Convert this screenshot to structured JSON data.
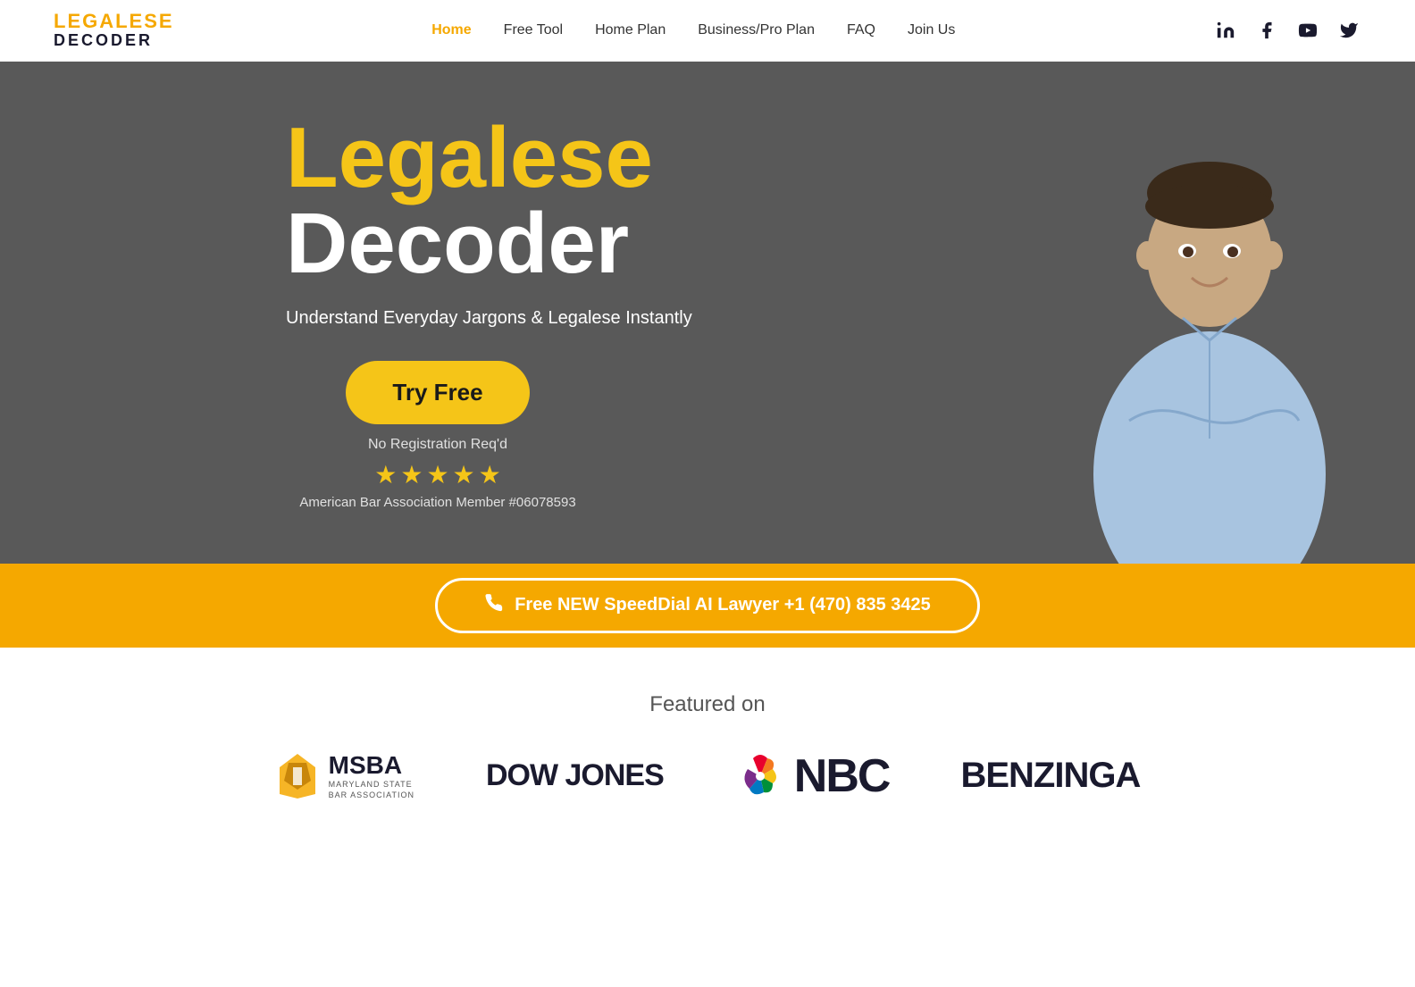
{
  "header": {
    "logo_top": "LEGALESE",
    "logo_bottom": "DECODER",
    "nav_items": [
      {
        "label": "Home",
        "active": true
      },
      {
        "label": "Free Tool",
        "active": false
      },
      {
        "label": "Home Plan",
        "active": false
      },
      {
        "label": "Business/Pro Plan",
        "active": false
      },
      {
        "label": "FAQ",
        "active": false
      },
      {
        "label": "Join Us",
        "active": false
      }
    ],
    "social": [
      "linkedin",
      "facebook",
      "youtube",
      "twitter"
    ]
  },
  "hero": {
    "title_yellow": "Legalese",
    "title_white": "Decoder",
    "subtitle": "Understand Everyday Jargons & Legalese Instantly",
    "cta_button": "Try Free",
    "no_registration": "No Registration Req'd",
    "aba_text": "American Bar Association Member #06078593",
    "stars_count": 4.5
  },
  "speed_dial": {
    "label": "Free NEW SpeedDial AI Lawyer +1 (470) 835 3425"
  },
  "featured": {
    "title": "Featured on",
    "logos": [
      "MSBA",
      "DOW JONES",
      "NBC",
      "BENZINGA"
    ]
  }
}
